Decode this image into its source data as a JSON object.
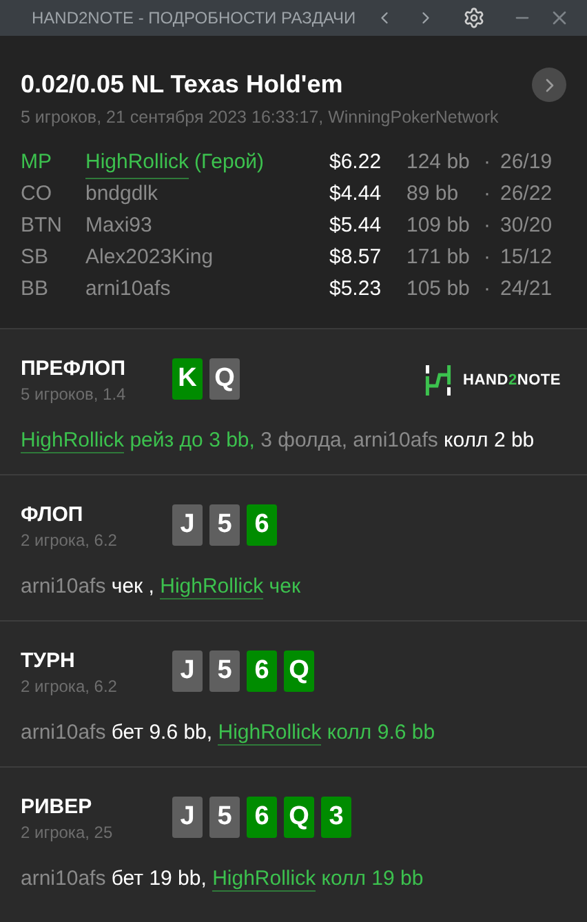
{
  "window": {
    "title": "HAND2NOTE - ПОДРОБНОСТИ РАЗДАЧИ"
  },
  "header": {
    "title": "0.02/0.05 NL Texas Hold'em",
    "subtitle": "5 игроков, 21 сентября 2023 16:33:17, WinningPokerNetwork"
  },
  "players": [
    {
      "position": "MP",
      "name": "HighRollick",
      "tag": "(Герой)",
      "hero": true,
      "stack": "$6.22",
      "bb": "124 bb",
      "dot": "·",
      "stats": "26/19"
    },
    {
      "position": "CO",
      "name": "bndgdlk",
      "hero": false,
      "stack": "$4.44",
      "bb": "89 bb",
      "dot": "·",
      "stats": "26/22"
    },
    {
      "position": "BTN",
      "name": "Maxi93",
      "hero": false,
      "stack": "$5.44",
      "bb": "109 bb",
      "dot": "·",
      "stats": "30/20"
    },
    {
      "position": "SB",
      "name": "Alex2023King",
      "hero": false,
      "stack": "$8.57",
      "bb": "171 bb",
      "dot": "·",
      "stats": "15/12"
    },
    {
      "position": "BB",
      "name": "arni10afs",
      "hero": false,
      "stack": "$5.23",
      "bb": "105 bb",
      "dot": "·",
      "stats": "24/21"
    }
  ],
  "logo": {
    "parts": [
      {
        "text": "HAND",
        "accent": false
      },
      {
        "text": "2",
        "accent": true
      },
      {
        "text": "NOTE",
        "accent": false
      }
    ]
  },
  "streets": [
    {
      "name": "ПРЕФЛОП",
      "info": "5 игроков, 1.4",
      "logo": true,
      "cards": [
        {
          "rank": "K",
          "color": "#008c00"
        },
        {
          "rank": "Q",
          "color": "#5f5f5f"
        }
      ],
      "actions": [
        {
          "kind": "hero",
          "text": "HighRollick"
        },
        {
          "kind": "hero-action",
          "text": " рейз до 3 bb,"
        },
        {
          "kind": "plain",
          "text": " 3 фолда, "
        },
        {
          "kind": "player",
          "text": "arni10afs"
        },
        {
          "kind": "action",
          "text": " колл 2 bb"
        }
      ]
    },
    {
      "name": "ФЛОП",
      "info": "2 игрока, 6.2",
      "logo": false,
      "cards": [
        {
          "rank": "J",
          "color": "#5f5f5f"
        },
        {
          "rank": "5",
          "color": "#5f5f5f"
        },
        {
          "rank": "6",
          "color": "#008c00"
        }
      ],
      "actions": [
        {
          "kind": "player",
          "text": "arni10afs"
        },
        {
          "kind": "action",
          "text": " чек , "
        },
        {
          "kind": "hero",
          "text": "HighRollick"
        },
        {
          "kind": "hero-action",
          "text": " чек"
        }
      ]
    },
    {
      "name": "ТУРН",
      "info": "2 игрока, 6.2",
      "logo": false,
      "cards": [
        {
          "rank": "J",
          "color": "#5f5f5f"
        },
        {
          "rank": "5",
          "color": "#5f5f5f"
        },
        {
          "rank": "6",
          "color": "#008c00"
        },
        {
          "rank": "Q",
          "color": "#008c00"
        }
      ],
      "actions": [
        {
          "kind": "player",
          "text": "arni10afs"
        },
        {
          "kind": "action",
          "text": " бет 9.6 bb, "
        },
        {
          "kind": "hero",
          "text": "HighRollick"
        },
        {
          "kind": "hero-action",
          "text": " колл 9.6 bb"
        }
      ]
    },
    {
      "name": "РИВЕР",
      "info": "2 игрока, 25",
      "logo": false,
      "cards": [
        {
          "rank": "J",
          "color": "#5f5f5f"
        },
        {
          "rank": "5",
          "color": "#5f5f5f"
        },
        {
          "rank": "6",
          "color": "#008c00"
        },
        {
          "rank": "Q",
          "color": "#008c00"
        },
        {
          "rank": "3",
          "color": "#008c00"
        }
      ],
      "actions": [
        {
          "kind": "player",
          "text": "arni10afs"
        },
        {
          "kind": "action",
          "text": " бет 19 bb, "
        },
        {
          "kind": "hero",
          "text": "HighRollick"
        },
        {
          "kind": "hero-action",
          "text": " колл 19 bb"
        }
      ]
    }
  ]
}
